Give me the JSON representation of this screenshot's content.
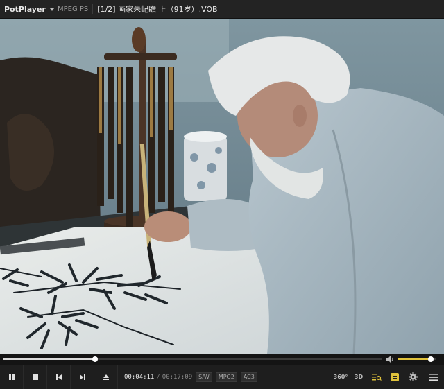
{
  "app": {
    "name": "PotPlayer",
    "format": "MPEG PS"
  },
  "media": {
    "title": "[1/2] 画家朱屺瞻 上（91岁）.VOB"
  },
  "playback": {
    "current_time": "00:04:11",
    "total_time": "00:17:09",
    "progress": 0.244,
    "volume": 0.87
  },
  "tags": {
    "sw": "S/W",
    "video_codec": "MPG2",
    "audio_codec": "AC3"
  },
  "tools": {
    "degree360": "360°",
    "three_d": "3D"
  },
  "icons": [
    "pause-icon",
    "stop-icon",
    "previous-icon",
    "next-icon",
    "eject-icon",
    "volume-icon",
    "360-icon",
    "3d-icon",
    "playlist-icon",
    "subtitle-icon",
    "settings-icon",
    "menu-icon"
  ],
  "colors": {
    "accent": "#e0c23b",
    "seek": "#d9d9d9",
    "background": "#1b1b1b"
  }
}
